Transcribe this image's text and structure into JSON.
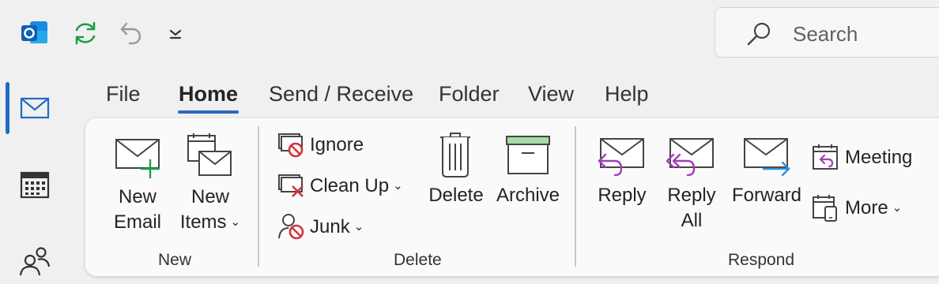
{
  "quick_access": {
    "app_icon": "outlook-icon",
    "refresh_icon": "sync-icon",
    "undo_icon": "undo-icon",
    "customize_icon": "chevron-down-icon"
  },
  "search": {
    "placeholder": "Search"
  },
  "rail": {
    "items": [
      {
        "name": "mail-icon",
        "active": true
      },
      {
        "name": "calendar-icon",
        "active": false
      },
      {
        "name": "people-icon",
        "active": false
      }
    ]
  },
  "tabs": [
    {
      "label": "File"
    },
    {
      "label": "Home",
      "active": true
    },
    {
      "label": "Send / Receive"
    },
    {
      "label": "Folder"
    },
    {
      "label": "View"
    },
    {
      "label": "Help"
    }
  ],
  "ribbon": {
    "new": {
      "group_label": "New",
      "new_email": {
        "line1": "New",
        "line2": "Email"
      },
      "new_items": {
        "line1": "New",
        "line2": "Items"
      }
    },
    "delete": {
      "group_label": "Delete",
      "ignore": "Ignore",
      "clean_up": "Clean Up",
      "junk": "Junk",
      "delete": "Delete",
      "archive": "Archive"
    },
    "respond": {
      "group_label": "Respond",
      "reply": "Reply",
      "reply_all": {
        "line1": "Reply",
        "line2": "All"
      },
      "forward": "Forward",
      "meeting": "Meeting",
      "more": "More"
    }
  },
  "colors": {
    "accent": "#1f6bc7",
    "reply_purple": "#a23fb5",
    "forward_blue": "#2f8fd6",
    "delete_red": "#d13438",
    "new_green": "#1e9e45",
    "archive_green": "#a8dba4"
  }
}
